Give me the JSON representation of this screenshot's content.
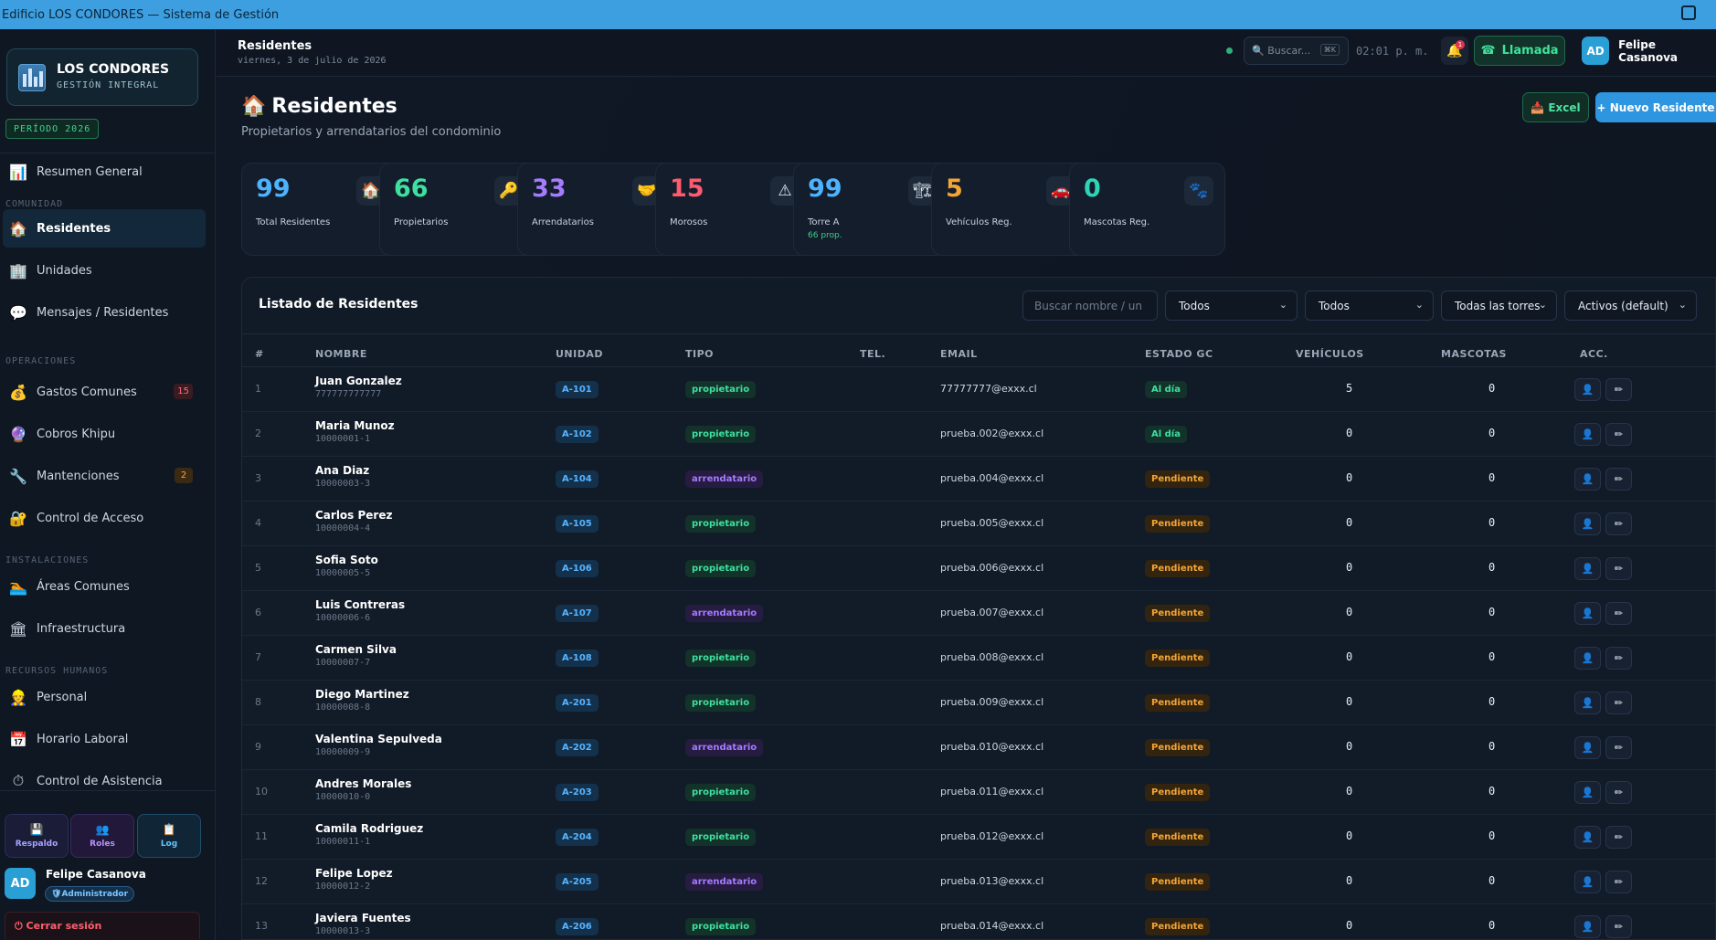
{
  "window": {
    "title": "Edificio LOS CONDORES — Sistema de Gestión"
  },
  "sidebar": {
    "brand_name": "LOS CONDORES",
    "brand_sub": "GESTIÓN INTEGRAL",
    "periodo": "PERÍODO 2026",
    "resumen": "Resumen General",
    "sections": {
      "comunidad": "COMUNIDAD",
      "operaciones": "OPERACIONES",
      "instalaciones": "INSTALACIONES",
      "rrhh": "RECURSOS HUMANOS"
    },
    "items": {
      "residentes": "Residentes",
      "unidades": "Unidades",
      "mensajes": "Mensajes / Residentes",
      "gastos": "Gastos Comunes",
      "gastos_count": "15",
      "khipu": "Cobros Khipu",
      "mantenciones": "Mantenciones",
      "mantenciones_count": "2",
      "acceso": "Control de Acceso",
      "areas": "Áreas Comunes",
      "infra": "Infraestructura",
      "personal": "Personal",
      "horario": "Horario Laboral",
      "asistencia": "Control de Asistencia"
    },
    "tiles": {
      "respaldo": "Respaldo",
      "roles": "Roles",
      "log": "Log"
    },
    "user": {
      "initials": "AD",
      "name": "Felipe Casanova",
      "role": "Administrador"
    },
    "logout": "Cerrar sesión"
  },
  "topbar": {
    "title": "Residentes",
    "date": "viernes, 3 de julio de 2026",
    "search_placeholder": "Buscar...",
    "shortcut": "⌘K",
    "clock": "02:01 p. m.",
    "notif_count": "1",
    "call": "Llamada",
    "user_initials": "AD",
    "user_name": "Felipe Casanova"
  },
  "page": {
    "title": "Residentes",
    "subtitle": "Propietarios y arrendatarios del condominio",
    "excel": "Excel",
    "new_resident": "+ Nuevo Residente"
  },
  "stats": [
    {
      "value": "99",
      "label": "Total Residentes",
      "color": "#4db3ff"
    },
    {
      "value": "66",
      "label": "Propietarios",
      "color": "#3ee0a0"
    },
    {
      "value": "33",
      "label": "Arrendatarios",
      "color": "#a57bff"
    },
    {
      "value": "15",
      "label": "Morosos",
      "color": "#ff5a6e"
    },
    {
      "value": "99",
      "label": "Torre A",
      "sub": "66 prop.",
      "color": "#4db3ff"
    },
    {
      "value": "5",
      "label": "Vehículos Reg.",
      "color": "#f3a536"
    },
    {
      "value": "0",
      "label": "Mascotas Reg.",
      "color": "#2fd4b8"
    }
  ],
  "table": {
    "title": "Listado de Residentes",
    "filters": {
      "search_placeholder": "Buscar nombre / un",
      "tipo": "Todos",
      "estado": "Todos",
      "torre": "Todas las torres",
      "activos": "Activos (default)"
    },
    "columns": [
      "#",
      "NOMBRE",
      "UNIDAD",
      "TIPO",
      "TEL.",
      "EMAIL",
      "ESTADO GC",
      "VEHÍCULOS",
      "MASCOTAS",
      "ACC."
    ],
    "rows": [
      {
        "idx": "1",
        "name": "Juan Gonzalez",
        "rut": "777777777777",
        "unit": "A-101",
        "type": "propietario",
        "email": "77777777@exxx.cl",
        "estado": "Al día",
        "veh": "5",
        "mas": "0"
      },
      {
        "idx": "2",
        "name": "Maria Munoz",
        "rut": "10000001-1",
        "unit": "A-102",
        "type": "propietario",
        "email": "prueba.002@exxx.cl",
        "estado": "Al día",
        "veh": "0",
        "mas": "0"
      },
      {
        "idx": "3",
        "name": "Ana Diaz",
        "rut": "10000003-3",
        "unit": "A-104",
        "type": "arrendatario",
        "email": "prueba.004@exxx.cl",
        "estado": "Pendiente",
        "veh": "0",
        "mas": "0"
      },
      {
        "idx": "4",
        "name": "Carlos Perez",
        "rut": "10000004-4",
        "unit": "A-105",
        "type": "propietario",
        "email": "prueba.005@exxx.cl",
        "estado": "Pendiente",
        "veh": "0",
        "mas": "0"
      },
      {
        "idx": "5",
        "name": "Sofia Soto",
        "rut": "10000005-5",
        "unit": "A-106",
        "type": "propietario",
        "email": "prueba.006@exxx.cl",
        "estado": "Pendiente",
        "veh": "0",
        "mas": "0"
      },
      {
        "idx": "6",
        "name": "Luis Contreras",
        "rut": "10000006-6",
        "unit": "A-107",
        "type": "arrendatario",
        "email": "prueba.007@exxx.cl",
        "estado": "Pendiente",
        "veh": "0",
        "mas": "0"
      },
      {
        "idx": "7",
        "name": "Carmen Silva",
        "rut": "10000007-7",
        "unit": "A-108",
        "type": "propietario",
        "email": "prueba.008@exxx.cl",
        "estado": "Pendiente",
        "veh": "0",
        "mas": "0"
      },
      {
        "idx": "8",
        "name": "Diego Martinez",
        "rut": "10000008-8",
        "unit": "A-201",
        "type": "propietario",
        "email": "prueba.009@exxx.cl",
        "estado": "Pendiente",
        "veh": "0",
        "mas": "0"
      },
      {
        "idx": "9",
        "name": "Valentina Sepulveda",
        "rut": "10000009-9",
        "unit": "A-202",
        "type": "arrendatario",
        "email": "prueba.010@exxx.cl",
        "estado": "Pendiente",
        "veh": "0",
        "mas": "0"
      },
      {
        "idx": "10",
        "name": "Andres Morales",
        "rut": "10000010-0",
        "unit": "A-203",
        "type": "propietario",
        "email": "prueba.011@exxx.cl",
        "estado": "Pendiente",
        "veh": "0",
        "mas": "0"
      },
      {
        "idx": "11",
        "name": "Camila Rodriguez",
        "rut": "10000011-1",
        "unit": "A-204",
        "type": "propietario",
        "email": "prueba.012@exxx.cl",
        "estado": "Pendiente",
        "veh": "0",
        "mas": "0"
      },
      {
        "idx": "12",
        "name": "Felipe Lopez",
        "rut": "10000012-2",
        "unit": "A-205",
        "type": "arrendatario",
        "email": "prueba.013@exxx.cl",
        "estado": "Pendiente",
        "veh": "0",
        "mas": "0"
      },
      {
        "idx": "13",
        "name": "Javiera Fuentes",
        "rut": "10000013-3",
        "unit": "A-206",
        "type": "propietario",
        "email": "prueba.014@exxx.cl",
        "estado": "Pendiente",
        "veh": "0",
        "mas": "0"
      }
    ]
  }
}
